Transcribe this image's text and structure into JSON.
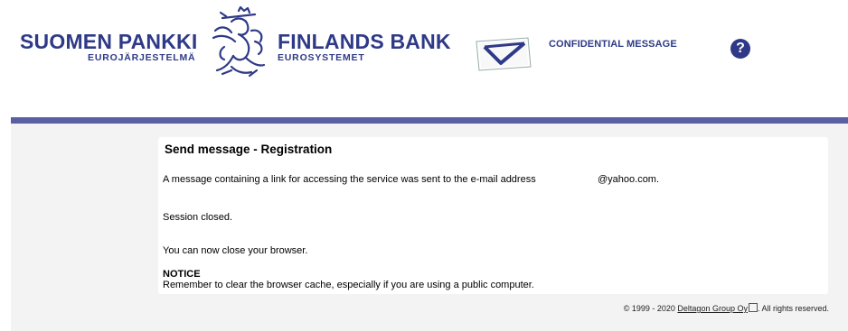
{
  "header": {
    "logo_fi": {
      "name": "SUOMEN PANKKI",
      "sub": "EUROJÄRJESTELMÄ"
    },
    "logo_sv": {
      "name": "FINLANDS BANK",
      "sub": "EUROSYSTEMET"
    },
    "confidential_label": "CONFIDENTIAL MESSAGE",
    "help_label": "?"
  },
  "panel": {
    "title": "Send message - Registration",
    "message": "A message containing a link for accessing the service was sent to the e-mail address",
    "email": "@yahoo.com.",
    "session": "Session closed.",
    "close_browser": "You can now close your browser.",
    "notice_title": "NOTICE",
    "notice_text": "Remember to clear the browser cache, especially if you are using a public computer."
  },
  "footer": {
    "copyright": "© 1999 - 2020 ",
    "company_link": "Deltagon Group Oy",
    "rights": ". All rights reserved."
  },
  "colors": {
    "brand": "#2e3a87",
    "bar": "#5a5fa4",
    "background": "#f3f3f3"
  },
  "icons": [
    "lion-crest-icon",
    "envelope-icon",
    "help-icon",
    "external-link-icon"
  ]
}
